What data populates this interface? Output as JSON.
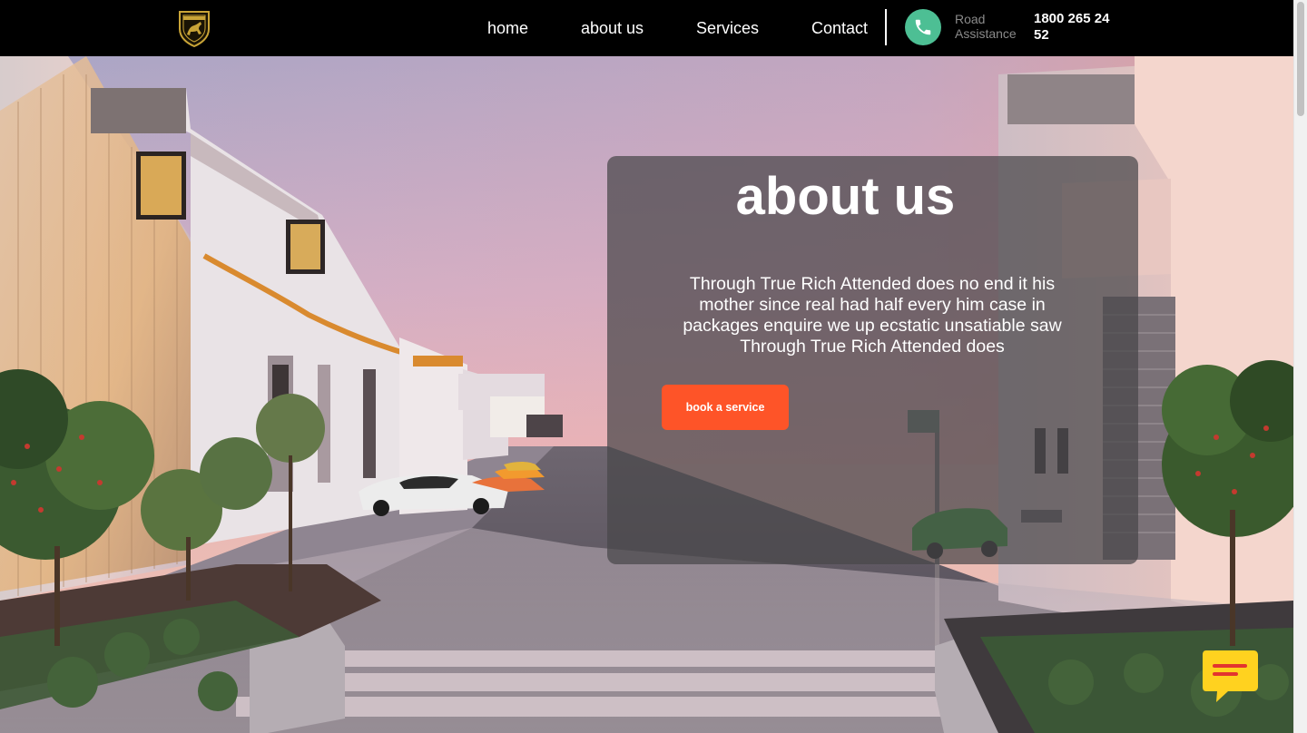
{
  "nav": {
    "logo_icon": "lamborghini-shield-icon",
    "items": [
      {
        "label": "home"
      },
      {
        "label": "about us"
      },
      {
        "label": "Services"
      },
      {
        "label": "Contact"
      }
    ],
    "road_assistance": {
      "icon": "phone-icon",
      "label": "Road Assistance",
      "number": "1800 265 24 52"
    }
  },
  "hero": {
    "title": "about us",
    "body": "Through True Rich Attended does no end it his mother since real had half every him case in packages enquire we up ecstatic unsatiable saw Through True Rich Attended does",
    "cta_label": "book a service"
  },
  "chat_widget": {
    "icon": "chat-bubble-icon"
  },
  "colors": {
    "nav_background": "#000000",
    "cta": "#fe5428",
    "phone_badge": "#4dbf94",
    "chat_widget": "#ffd21f"
  }
}
